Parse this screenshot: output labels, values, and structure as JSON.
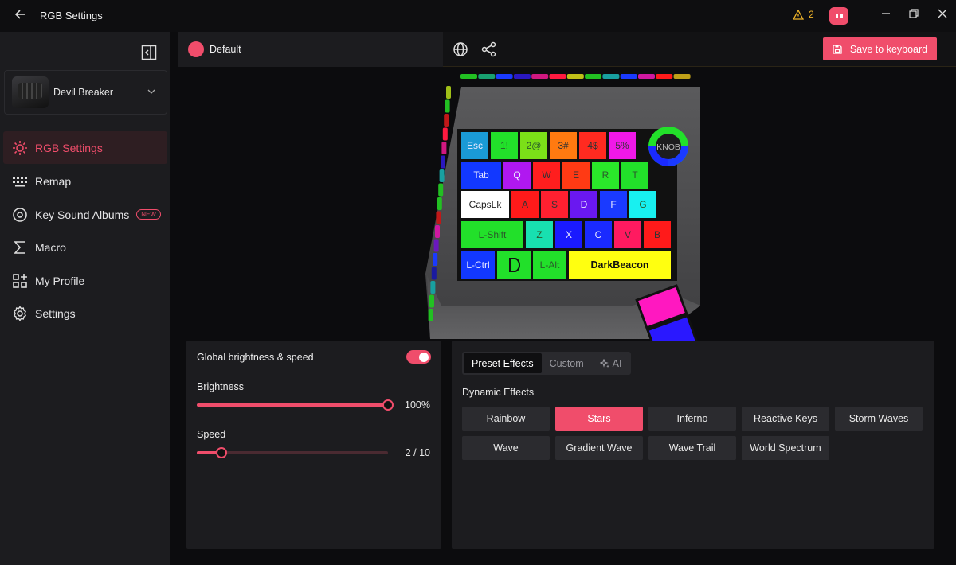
{
  "window": {
    "title": "RGB Settings",
    "warning_count": "2"
  },
  "sidebar": {
    "device_name": "Devil Breaker",
    "items": [
      {
        "label": "RGB Settings",
        "icon": "sun-icon",
        "active": true
      },
      {
        "label": "Remap",
        "icon": "keyboard-icon"
      },
      {
        "label": "Key Sound Albums",
        "icon": "disc-icon",
        "badge": "NEW"
      },
      {
        "label": "Macro",
        "icon": "sigma-icon"
      },
      {
        "label": "My Profile",
        "icon": "grid-plus-icon"
      },
      {
        "label": "Settings",
        "icon": "gear-icon"
      }
    ]
  },
  "header": {
    "profile_name": "Default",
    "profile_color": "#f04d6b",
    "save_label": "Save to keyboard"
  },
  "keyboard": {
    "rows": [
      [
        {
          "label": "Esc",
          "color": "#1a9ad6"
        },
        {
          "label": "1!",
          "color": "#22e02a"
        },
        {
          "label": "2@",
          "color": "#7be018"
        },
        {
          "label": "3#",
          "color": "#ff7a10"
        },
        {
          "label": "4$",
          "color": "#ff2a20"
        },
        {
          "label": "5%",
          "color": "#f018e8"
        }
      ],
      [
        {
          "label": "Tab",
          "color": "#1238ff"
        },
        {
          "label": "Q",
          "color": "#b018f0"
        },
        {
          "label": "W",
          "color": "#ff1e1e"
        },
        {
          "label": "E",
          "color": "#ff3a14"
        },
        {
          "label": "R",
          "color": "#2ae82a"
        },
        {
          "label": "T",
          "color": "#22e02a"
        }
      ],
      [
        {
          "label": "CapsLk",
          "color": "#ffffff"
        },
        {
          "label": "A",
          "color": "#ff1a1a"
        },
        {
          "label": "S",
          "color": "#ff2030"
        },
        {
          "label": "D",
          "color": "#6a18f0"
        },
        {
          "label": "F",
          "color": "#1a3aff"
        },
        {
          "label": "G",
          "color": "#18f0f0"
        }
      ],
      [
        {
          "label": "L-Shift",
          "color": "#22e02a"
        },
        {
          "label": "Z",
          "color": "#18e0b0"
        },
        {
          "label": "X",
          "color": "#1a1aff"
        },
        {
          "label": "C",
          "color": "#1a2aff"
        },
        {
          "label": "V",
          "color": "#ff1a60"
        },
        {
          "label": "B",
          "color": "#ff1a1a"
        }
      ],
      [
        {
          "label": "L-Ctrl",
          "color": "#1238ff"
        },
        {
          "label": "",
          "color": "#22e02a",
          "logo": true
        },
        {
          "label": "L-Alt",
          "color": "#22e02a"
        },
        {
          "label": "DarkBeacon",
          "color": "#ffff10"
        }
      ]
    ],
    "knob_label": "KNOB",
    "thumb_keys": [
      "#ff18c0",
      "#2a18ff"
    ],
    "top_strip": [
      "#22c022",
      "#18a070",
      "#1a3aff",
      "#2a18c0",
      "#d01880",
      "#ff1a40",
      "#c0c018",
      "#22c022",
      "#18a0a0",
      "#1a3aff",
      "#d018a0",
      "#ff1a1a",
      "#c0a018"
    ],
    "side_strip": [
      "#a0c018",
      "#22c022",
      "#c01818",
      "#ff1a40",
      "#d01880",
      "#2a18c0",
      "#18a0a0",
      "#22c022",
      "#22c022",
      "#c01818",
      "#d018a0",
      "#6a18c0",
      "#1a3aff",
      "#1a1aa0",
      "#18a0a0",
      "#22c022",
      "#22c022"
    ]
  },
  "brightness_panel": {
    "global_label": "Global brightness & speed",
    "global_on": true,
    "brightness_label": "Brightness",
    "brightness_value": "100%",
    "brightness_fraction": 1.0,
    "speed_label": "Speed",
    "speed_value": "2 / 10",
    "speed_fraction": 0.13
  },
  "effects_panel": {
    "tabs": [
      {
        "label": "Preset Effects",
        "active": true
      },
      {
        "label": "Custom"
      },
      {
        "label": "AI",
        "icon": "sparkle-icon"
      }
    ],
    "section_title": "Dynamic Effects",
    "effects": [
      "Rainbow",
      "Stars",
      "Inferno",
      "Reactive Keys",
      "Storm Waves",
      "Wave",
      "Gradient Wave",
      "Wave Trail",
      "World Spectrum"
    ],
    "selected": "Stars"
  },
  "colors": {
    "accent": "#f04d6b",
    "warning": "#f0b429"
  }
}
